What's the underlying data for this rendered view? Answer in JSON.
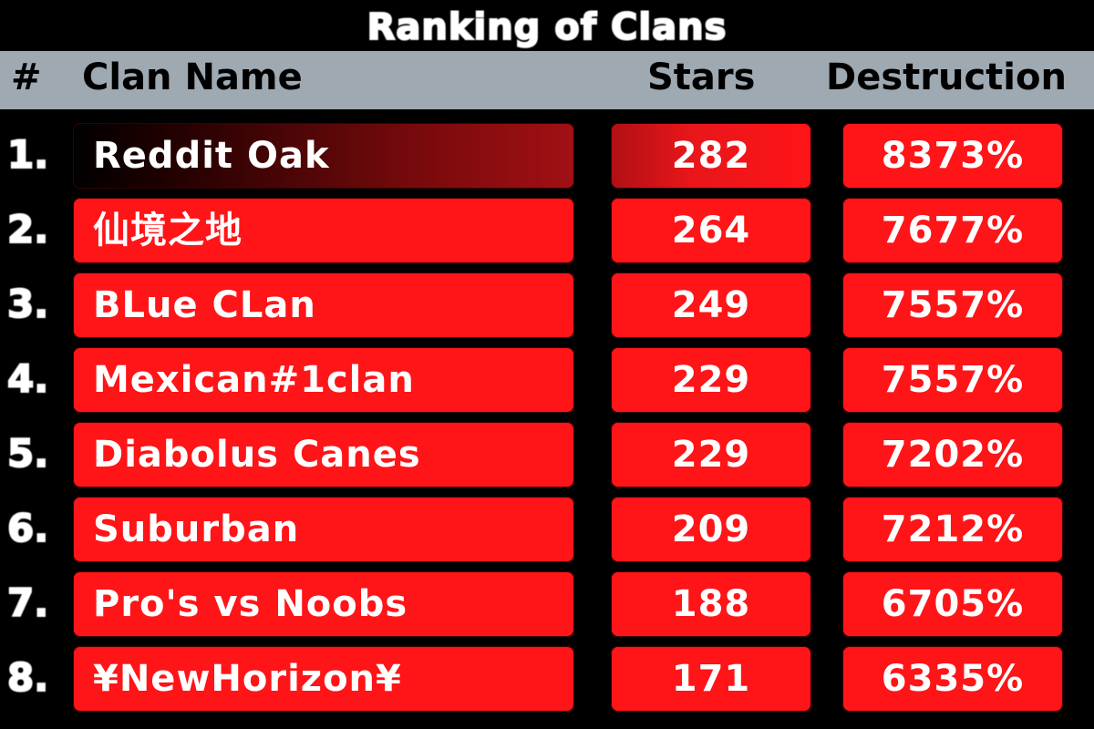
{
  "title": "Ranking of Clans",
  "header": {
    "rank": "#",
    "name": "Clan Name",
    "stars": "Stars",
    "destruction": "Destruction"
  },
  "colors": {
    "background": "#000000",
    "header": "#9ea9b1",
    "row": "#ff1418",
    "text": "#ffffff"
  },
  "rows": [
    {
      "rank": "1.",
      "name": "Reddit Oak",
      "stars": "282",
      "destruction": "8373%"
    },
    {
      "rank": "2.",
      "name": "仙境之地",
      "stars": "264",
      "destruction": "7677%"
    },
    {
      "rank": "3.",
      "name": "BLue CLan",
      "stars": "249",
      "destruction": "7557%"
    },
    {
      "rank": "4.",
      "name": "Mexican#1clan",
      "stars": "229",
      "destruction": "7557%"
    },
    {
      "rank": "5.",
      "name": "Diabolus Canes",
      "stars": "229",
      "destruction": "7202%"
    },
    {
      "rank": "6.",
      "name": "Suburban",
      "stars": "209",
      "destruction": "7212%"
    },
    {
      "rank": "7.",
      "name": "Pro's vs Noobs",
      "stars": "188",
      "destruction": "6705%"
    },
    {
      "rank": "8.",
      "name": "¥NewHorizon¥",
      "stars": "171",
      "destruction": "6335%"
    }
  ]
}
